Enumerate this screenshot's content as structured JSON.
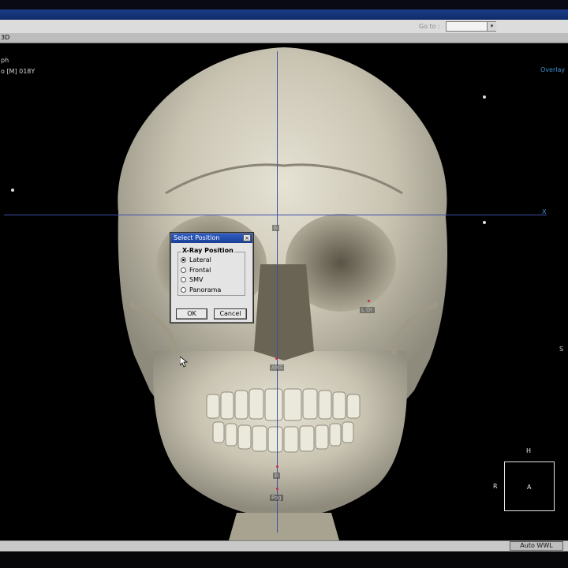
{
  "toolbar": {
    "goto_label": "Go to :",
    "goto_value": ""
  },
  "tab": {
    "label": "3D"
  },
  "overlay": {
    "line1": "ph",
    "line2": "o [M] 018Y",
    "overlay_link": "Overlay",
    "right_edge": "S"
  },
  "landmarks": {
    "n": "N",
    "lor": "L Or",
    "ans": "ANS",
    "b": "B",
    "pog": "Pog",
    "x": "X"
  },
  "orientation": {
    "top": "H",
    "left": "R",
    "center": "A"
  },
  "dialog": {
    "title": "Select Position",
    "close": "×",
    "group_label": "X-Ray Position",
    "options": [
      "Lateral",
      "Frontal",
      "SMV",
      "Panorama"
    ],
    "selected": "Lateral",
    "ok_label": "OK",
    "cancel_label": "Cancel"
  },
  "status": {
    "auto_wwl": "Auto WWL"
  },
  "colors": {
    "crosshair": "#3d4fa8",
    "dialog_title": "#2e5ec8",
    "accent_link": "#3d8fd6"
  }
}
